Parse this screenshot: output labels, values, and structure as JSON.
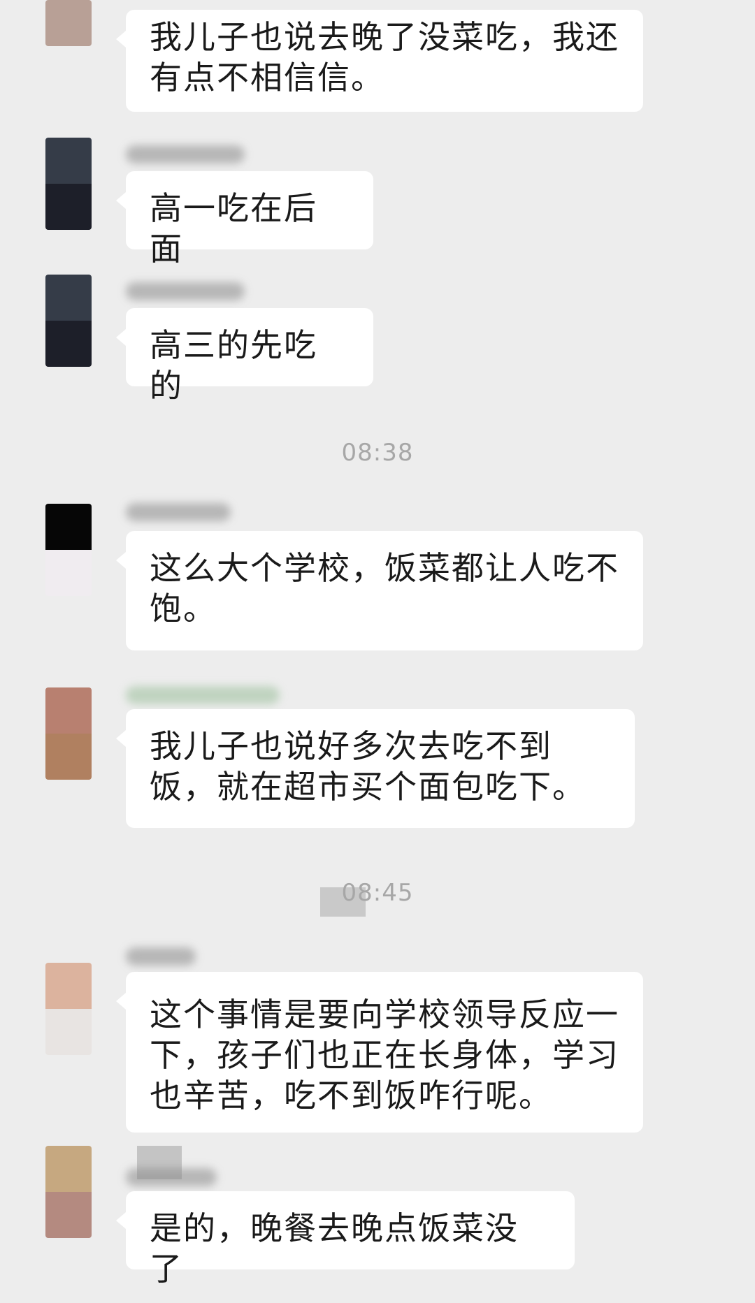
{
  "messages": [
    {
      "text": "我儿子也说去晚了没菜吃，我还有点不相信信。",
      "avatar_colors": [
        "#b8a096",
        "#b8a096"
      ]
    },
    {
      "text": "高一吃在后面",
      "avatar_colors": [
        "#353c48",
        "#1d1f29"
      ]
    },
    {
      "text": "高三的先吃的",
      "avatar_colors": [
        "#353c48",
        "#1d1f29"
      ]
    },
    {
      "text": "这么大个学校，饭菜都让人吃不饱。",
      "avatar_colors": [
        "#060606",
        "#f0ecf0"
      ]
    },
    {
      "text": "我儿子也说好多次去吃不到饭，就在超市买个面包吃下。",
      "avatar_colors": [
        "#b88070",
        "#b08060"
      ]
    },
    {
      "text": "这个事情是要向学校领导反应一下，孩子们也正在长身体，学习也辛苦，吃不到饭咋行呢。",
      "avatar_colors": [
        "#dcb39e",
        "#e8e4e2"
      ]
    },
    {
      "text": "是的，晚餐去晚点饭菜没了",
      "avatar_colors": [
        "#c6a880",
        "#b48a80"
      ]
    }
  ],
  "timestamps": {
    "first": "08:38",
    "second": "08:45"
  },
  "colors": {
    "background": "#ededed",
    "bubble": "#ffffff",
    "text": "#1a1a1a",
    "timestamp": "#a7a7a7"
  }
}
